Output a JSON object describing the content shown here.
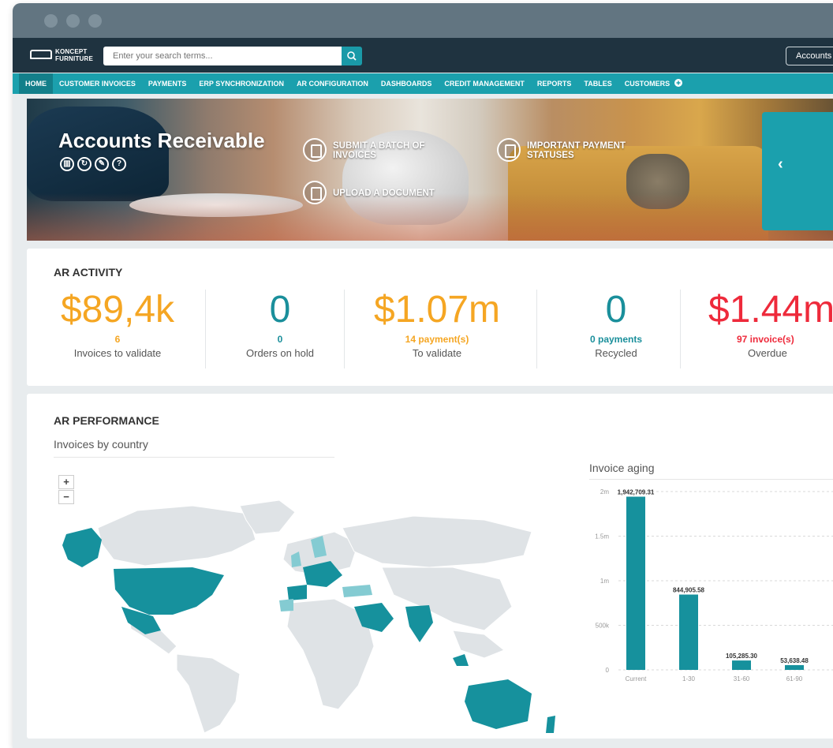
{
  "app": {
    "search_placeholder": "Enter your search terms...",
    "accounts_button": "Accounts",
    "logo_text": "KONCEPT FURNITURE"
  },
  "nav": [
    {
      "label": "HOME",
      "active": true
    },
    {
      "label": "CUSTOMER INVOICES"
    },
    {
      "label": "PAYMENTS"
    },
    {
      "label": "ERP SYNCHRONIZATION"
    },
    {
      "label": "AR CONFIGURATION"
    },
    {
      "label": "DASHBOARDS"
    },
    {
      "label": "CREDIT MANAGEMENT"
    },
    {
      "label": "REPORTS"
    },
    {
      "label": "TABLES"
    },
    {
      "label": "CUSTOMERS"
    }
  ],
  "hero": {
    "title": "Accounts Receivable",
    "actions": {
      "submit": "SUBMIT A BATCH OF INVOICES",
      "upload": "UPLOAD A DOCUMENT",
      "statuses": "IMPORTANT PAYMENT STATUSES"
    }
  },
  "ar_activity": {
    "title": "AR ACTIVITY",
    "kpis": [
      {
        "value": "$89,4k",
        "sub": "6",
        "caption": "Invoices to validate",
        "color": "#f5a623"
      },
      {
        "value": "0",
        "sub": "0",
        "caption": "Orders on hold",
        "color": "#1a8f9b"
      },
      {
        "value": "$1.07m",
        "sub": "14 payment(s)",
        "caption": "To validate",
        "color": "#f5a623"
      },
      {
        "value": "0",
        "sub": "0 payments",
        "caption": "Recycled",
        "color": "#1a8f9b"
      },
      {
        "value": "$1.44m",
        "sub": "97 invoice(s)",
        "caption": "Overdue",
        "color": "#ee2a3b"
      }
    ]
  },
  "ar_performance": {
    "title": "AR PERFORMANCE",
    "map_title": "Invoices by country",
    "zoom_in": "+",
    "zoom_out": "−",
    "chart_title": "Invoice aging"
  },
  "chart_data": {
    "type": "bar",
    "categories": [
      "Current",
      "1-30",
      "31-60",
      "61-90"
    ],
    "values": [
      1942709.31,
      844905.58,
      105285.3,
      53638.48
    ],
    "data_labels": [
      "1,942,709.31",
      "844,905.58",
      "105,285.30",
      "53,638.48"
    ],
    "yticks": [
      "0",
      "500k",
      "1m",
      "1.5m",
      "2m"
    ],
    "ylim": [
      0,
      2000000
    ],
    "grid": true,
    "bar_color": "#16919d"
  }
}
